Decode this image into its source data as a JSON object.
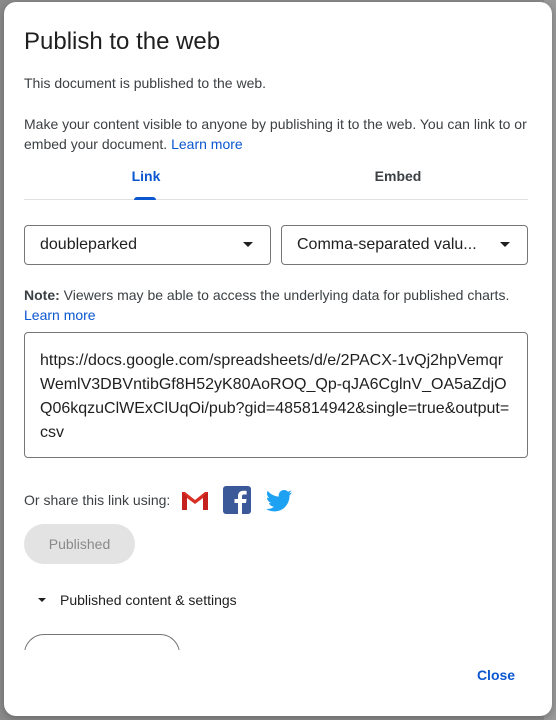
{
  "dialog": {
    "title": "Publish to the web",
    "status": "This document is published to the web.",
    "description": "Make your content visible to anyone by publishing it to the web. You can link to or embed your document.",
    "learn_more": "Learn more"
  },
  "tabs": [
    {
      "label": "Link",
      "active": true
    },
    {
      "label": "Embed",
      "active": false
    }
  ],
  "selects": {
    "document": "doubleparked",
    "format": "Comma-separated valu..."
  },
  "note": {
    "label": "Note:",
    "text": "Viewers may be able to access the underlying data for published charts.",
    "learn_more": "Learn more"
  },
  "url": "https://docs.google.com/spreadsheets/d/e/2PACX-1vQj2hpVemqrWemlV3DBVntibGf8H52yK80AoROQ_Qp-qJA6CglnV_OA5aZdjOQ06kqzuClWExClUqOi/pub?gid=485814942&single=true&output=csv",
  "share": {
    "label": "Or share this link using:",
    "icons": [
      "gmail-icon",
      "facebook-icon",
      "twitter-icon"
    ]
  },
  "published_button": "Published",
  "settings": "Published content & settings",
  "clipped_button": "",
  "close_button": "Close",
  "colors": {
    "accent": "#0b57d0",
    "disabled_bg": "#e3e3e3",
    "facebook": "#3b5998",
    "twitter": "#1da1f2",
    "gmail_red": "#d93025"
  }
}
